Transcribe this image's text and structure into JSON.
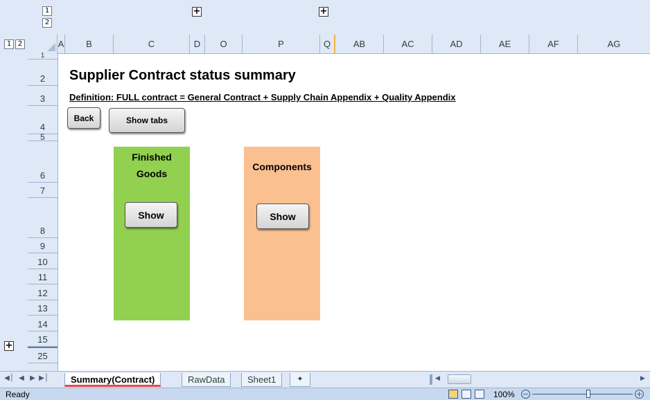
{
  "outline": {
    "column_levels": [
      "1",
      "2"
    ],
    "row_levels": [
      "1",
      "2"
    ],
    "expand_symbol": "+"
  },
  "columns": [
    "A",
    "B",
    "C",
    "D",
    "O",
    "P",
    "Q",
    "AB",
    "AC",
    "AD",
    "AE",
    "AF",
    "AG"
  ],
  "rows": [
    "1",
    "2",
    "3",
    "4",
    "5",
    "6",
    "7",
    "8",
    "9",
    "10",
    "11",
    "12",
    "13",
    "14",
    "15",
    "25"
  ],
  "sheet": {
    "title": "Supplier Contract status summary",
    "definition": "Definition: FULL contract = General Contract + Supply Chain Appendix + Quality Appendix",
    "back_label": "Back",
    "show_tabs_label": "Show tabs",
    "finished_goods": {
      "title_line1": "Finished",
      "title_line2": "Goods",
      "button": "Show",
      "color": "#92d050"
    },
    "components": {
      "title": "Components",
      "button": "Show",
      "color": "#fac090"
    }
  },
  "tabs": [
    {
      "label": "Summary(Contract)",
      "active": true
    },
    {
      "label": "RawData",
      "active": false
    },
    {
      "label": "Sheet1",
      "active": false
    }
  ],
  "status": {
    "ready": "Ready",
    "zoom": "100%"
  },
  "colors": {
    "header_bg": "#dfe8f6",
    "gridline": "#9eb6ce",
    "active_tab_underline": "#e8474c"
  }
}
